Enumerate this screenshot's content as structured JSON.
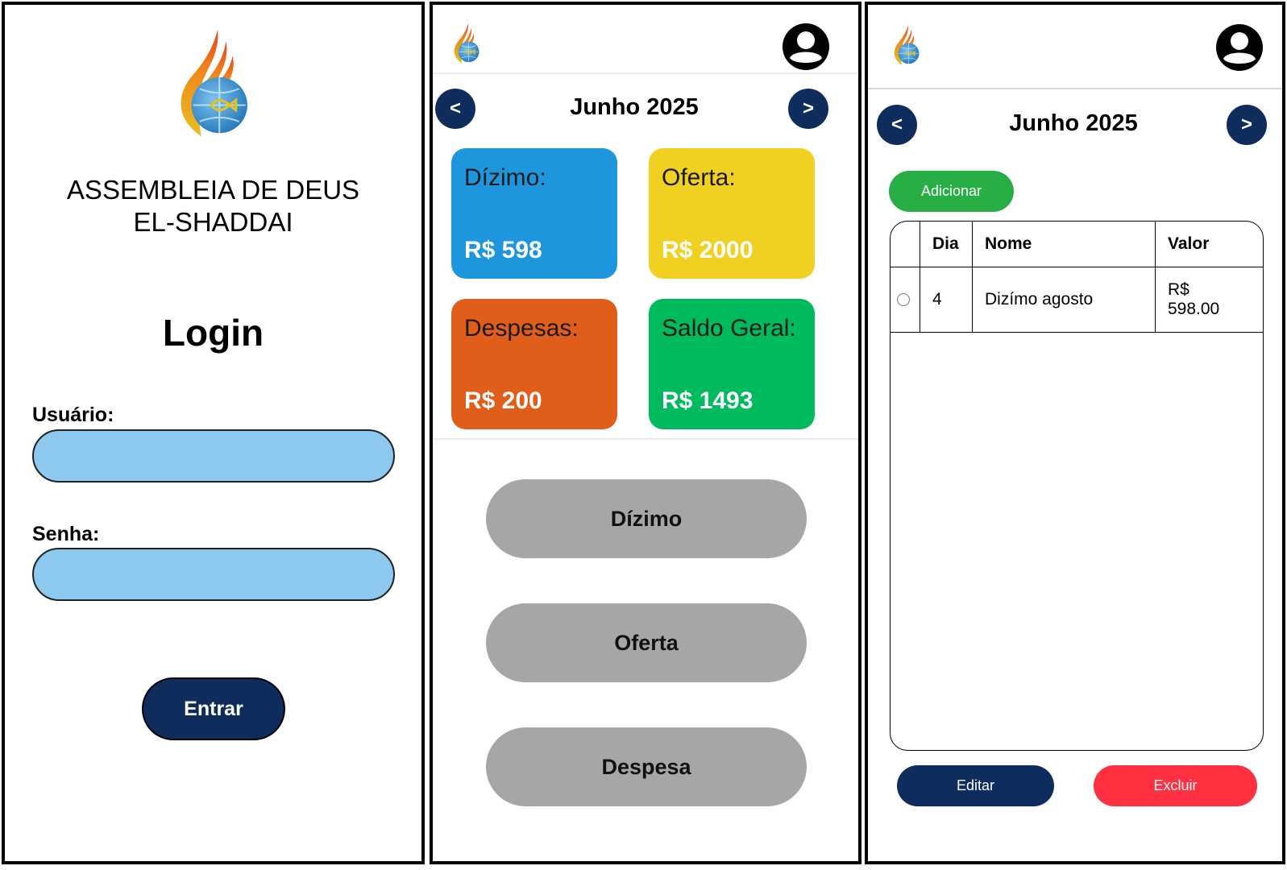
{
  "login": {
    "org_name_line1": "ASSEMBLEIA DE DEUS",
    "org_name_line2": "EL-SHADDAI",
    "title": "Login",
    "user_label": "Usuário:",
    "user_value": "",
    "password_label": "Senha:",
    "password_value": "",
    "submit_label": "Entrar"
  },
  "dashboard": {
    "month": "Junho 2025",
    "prev_label": "<",
    "next_label": ">",
    "cards": [
      {
        "label": "Dízimo:",
        "value": "R$ 598",
        "color": "#1e96de"
      },
      {
        "label": "Oferta:",
        "value": "R$ 2000",
        "color": "#f0d020"
      },
      {
        "label": "Despesas:",
        "value": "R$ 200",
        "color": "#e05e1a"
      },
      {
        "label": "Saldo Geral:",
        "value": "R$ 1493",
        "color": "#00bb5e"
      }
    ],
    "buttons": [
      "Dízimo",
      "Oferta",
      "Despesa"
    ]
  },
  "records": {
    "month": "Junho 2025",
    "prev_label": "<",
    "next_label": ">",
    "add_label": "Adicionar",
    "columns": [
      "Dia",
      "Nome",
      "Valor"
    ],
    "rows": [
      {
        "dia": "4",
        "nome": "Dizímo agosto",
        "valor_line1": "R$",
        "valor_line2": "598.00"
      }
    ],
    "edit_label": "Editar",
    "delete_label": "Excluir"
  },
  "colors": {
    "navy": "#0e2c5c",
    "field_blue": "#8dc8ee",
    "action_grey": "#a6a6a6",
    "add_green": "#27ae45",
    "delete_red": "#ff3040"
  },
  "icons": [
    "church-logo-icon",
    "user-account-icon"
  ]
}
